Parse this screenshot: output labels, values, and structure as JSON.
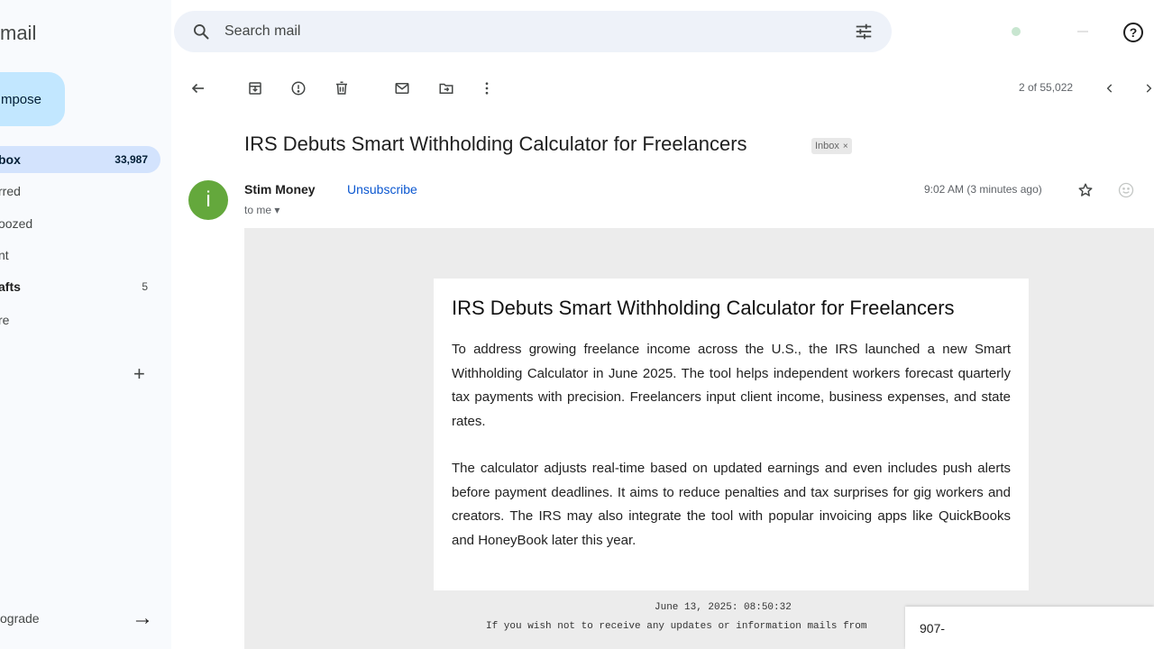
{
  "app": {
    "brand": "mail"
  },
  "sidebar": {
    "compose_label": "mpose",
    "items": [
      {
        "label": "box",
        "count": "33,987"
      },
      {
        "label": "rred",
        "count": ""
      },
      {
        "label": "oozed",
        "count": ""
      },
      {
        "label": "nt",
        "count": ""
      },
      {
        "label": "afts",
        "count": "5"
      },
      {
        "label": "re",
        "count": ""
      }
    ],
    "labels_add": "+",
    "upgrade_label": "ograde"
  },
  "search": {
    "placeholder": "Search mail",
    "value": ""
  },
  "toolbar": {
    "icons": [
      "back-arrow-icon",
      "archive-icon",
      "report-spam-icon",
      "delete-icon",
      "mark-unread-icon",
      "move-to-icon",
      "more-vert-icon"
    ],
    "pager": "2 of 55,022"
  },
  "email": {
    "subject": "IRS Debuts Smart Withholding Calculator for Freelancers",
    "label": "Inbox",
    "label_remove": "×",
    "avatar_letter": "i",
    "sender": "Stim Money",
    "unsubscribe": "Unsubscribe",
    "recipient": "to me ▾",
    "time": "9:02 AM (3 minutes ago)",
    "body": {
      "title": "IRS Debuts Smart Withholding Calculator for Freelancers",
      "paragraph1": "To address growing freelance income across the U.S., the IRS launched a new Smart Withholding Calculator in June 2025. The tool helps independent workers forecast quarterly tax payments with precision. Freelancers input client income, business expenses, and state rates.",
      "paragraph2": "The calculator adjusts real-time based on updated earnings and even includes push alerts before payment deadlines. It aims to reduce penalties and tax surprises for gig workers and creators. The IRS may also integrate the tool with popular invoicing apps like QuickBooks and HoneyBook later this year.",
      "footer_date": "June 13, 2025: 08:50:32",
      "footer_note": "If you wish not to receive any updates or information mails from"
    }
  },
  "overlay": {
    "text": "907-"
  },
  "colors": {
    "accent": "#0b57d0",
    "avatar": "#64a83c",
    "compose": "#c2e7ff",
    "active_nav": "#d3e3fd"
  }
}
